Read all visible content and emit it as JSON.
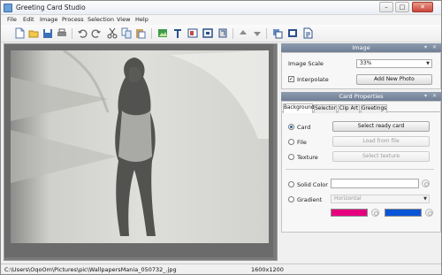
{
  "window": {
    "title": "Greeting Card Studio"
  },
  "menu": [
    "File",
    "Edit",
    "Image",
    "Process",
    "Selection",
    "View",
    "Help"
  ],
  "toolbar_icons": [
    "new-icon",
    "open-icon",
    "save-icon",
    "print-icon",
    "undo-icon",
    "redo-icon",
    "cut-icon",
    "copy-icon",
    "paste-icon",
    "image-icon",
    "text-icon",
    "card-icon",
    "frame-icon",
    "crop-icon",
    "up-arrow-icon",
    "down-arrow-icon",
    "send-back-icon",
    "bring-front-icon",
    "page-icon"
  ],
  "image_panel": {
    "title": "Image",
    "scale_label": "Image Scale",
    "scale_value": "33%",
    "interpolate_label": "Interpolate",
    "interpolate_checked": true,
    "add_photo_label": "Add New Photo"
  },
  "card_panel": {
    "title": "Card Properties",
    "tabs": [
      "Background",
      "Selector",
      "Clip Art",
      "Greetings"
    ],
    "active_tab": "Background",
    "card_label": "Card",
    "select_card_label": "Select ready card",
    "file_label": "File",
    "load_file_label": "Load from file",
    "texture_label": "Texture",
    "select_texture_label": "Select texture",
    "solid_color_label": "Solid Color",
    "gradient_label": "Gradient",
    "gradient_mode": "Horizontal",
    "gradient_color_1": "#e6007e",
    "gradient_color_2": "#0a55d6",
    "selected_option": "Card"
  },
  "status": {
    "path": "C:\\Users\\OqoOm\\Pictures\\pic\\WallpapersMania_050732_.jpg",
    "dimensions": "1600x1200"
  }
}
